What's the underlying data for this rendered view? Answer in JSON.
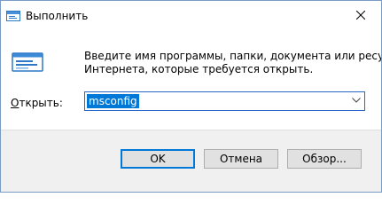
{
  "window": {
    "title": "Выполнить"
  },
  "main": {
    "description_line1": "Введите имя программы, папки, документа или ресурса",
    "description_line2": "Интернета, которые требуется открыть.",
    "open_label_hotkey": "О",
    "open_label_rest": "ткрыть:",
    "command_value": "msconfig"
  },
  "buttons": {
    "ok": "OK",
    "cancel": "Отмена",
    "browse": "Обзор..."
  },
  "icons": {
    "app": "run-dialog-icon",
    "close": "close-icon",
    "dropdown": "chevron-down-icon"
  },
  "colors": {
    "accent": "#0078d7",
    "selection_text": "#ffffff",
    "footer_bg": "#f0f0f0"
  }
}
